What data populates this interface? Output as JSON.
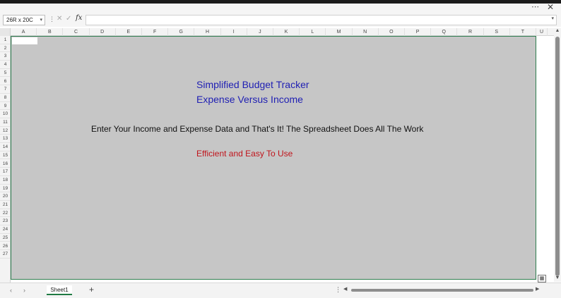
{
  "window": {
    "more_glyph": "⋯",
    "close_glyph": "✕"
  },
  "formula_bar": {
    "name_box": "26R x 20C",
    "fx_label": "fx",
    "formula_value": ""
  },
  "columns": [
    "A",
    "B",
    "C",
    "D",
    "E",
    "F",
    "G",
    "H",
    "I",
    "J",
    "K",
    "L",
    "M",
    "N",
    "O",
    "P",
    "Q",
    "R",
    "S",
    "T",
    "U"
  ],
  "rows": [
    "1",
    "2",
    "3",
    "4",
    "5",
    "6",
    "7",
    "8",
    "9",
    "10",
    "11",
    "12",
    "13",
    "14",
    "15",
    "16",
    "17",
    "18",
    "19",
    "20",
    "21",
    "22",
    "23",
    "24",
    "25",
    "26",
    "27"
  ],
  "content": {
    "title": "Simplified Budget Tracker",
    "subtitle": "Expense Versus Income",
    "instruction": "Enter Your Income and Expense Data and That's It! The Spreadsheet Does All The Work",
    "tagline": "Efficient and Easy To Use"
  },
  "sheets": {
    "tabs": [
      {
        "label": "Sheet1",
        "active": true
      }
    ],
    "add_label": "+"
  },
  "colors": {
    "title_blue": "#1f1fb3",
    "tagline_red": "#c0141b",
    "grid_fill": "#c6c6c6",
    "selection_border": "#2e7d4f"
  },
  "icons": {
    "cancel": "close-icon",
    "confirm": "check-icon",
    "function": "fx-icon",
    "quick_analysis": "quick-analysis-icon"
  }
}
